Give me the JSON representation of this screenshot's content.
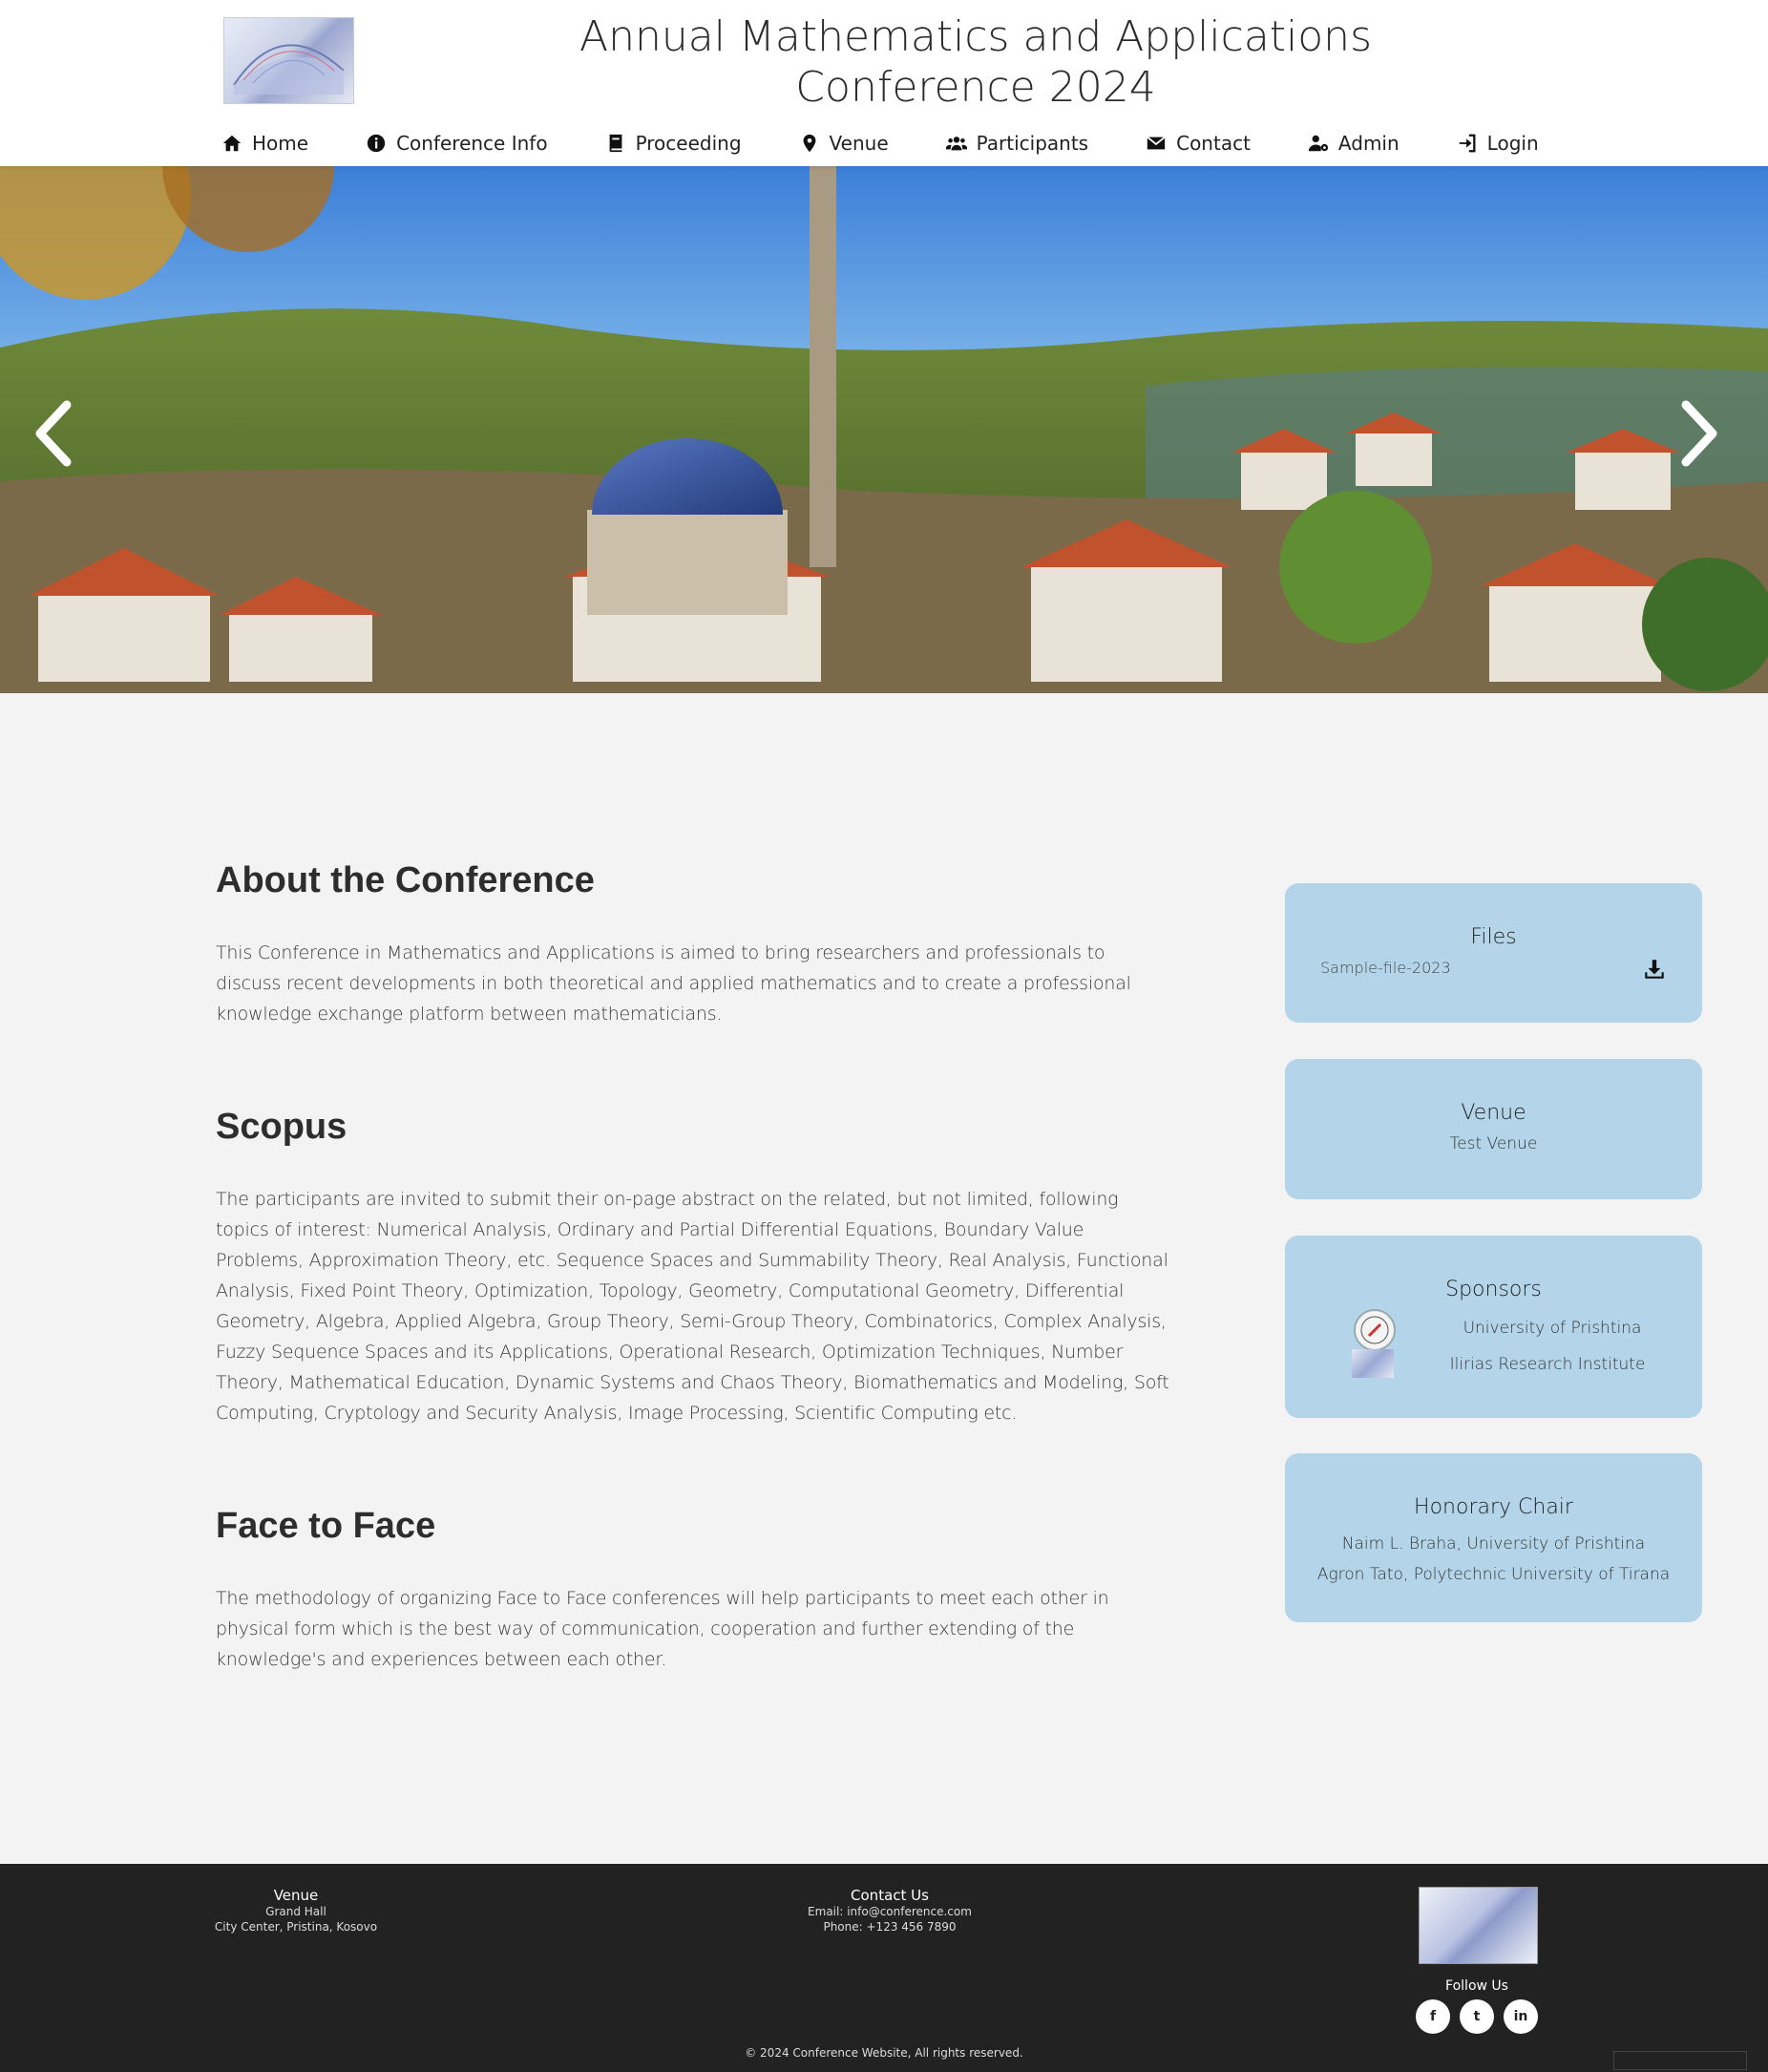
{
  "header": {
    "title_line1": "Annual Mathematics and Applications",
    "title_line2": "Conference 2024"
  },
  "nav": {
    "items": [
      {
        "label": "Home",
        "icon": "home-icon"
      },
      {
        "label": "Conference Info",
        "icon": "info-icon"
      },
      {
        "label": "Proceeding",
        "icon": "book-icon"
      },
      {
        "label": "Venue",
        "icon": "map-pin-icon"
      },
      {
        "label": "Participants",
        "icon": "users-icon"
      },
      {
        "label": "Contact",
        "icon": "envelope-icon"
      },
      {
        "label": "Admin",
        "icon": "user-cog-icon"
      },
      {
        "label": "Login",
        "icon": "login-icon"
      }
    ]
  },
  "about": {
    "title": "About the Conference",
    "text": "This Conference in Mathematics and Applications is aimed to bring researchers and professionals to discuss recent developments in both theoretical and applied mathematics and to create a professional knowledge exchange platform between mathematicians."
  },
  "scopus": {
    "title": "Scopus",
    "text": "The participants are invited to submit their on-page abstract on the related, but not limited, following topics of interest: Numerical Analysis, Ordinary and Partial Differential Equations, Boundary Value Problems, Approximation Theory, etc. Sequence Spaces and Summability Theory, Real Analysis, Functional Analysis, Fixed Point Theory, Optimization, Topology, Geometry, Computational Geometry, Differential Geometry, Algebra, Applied Algebra, Group Theory, Semi-Group Theory, Combinatorics, Complex Analysis, Fuzzy Sequence Spaces and its Applications, Operational Research, Optimization Techniques, Number Theory, Mathematical Education, Dynamic Systems and Chaos Theory, Biomathematics and Modeling, Soft Computing, Cryptology and Security Analysis, Image Processing, Scientific Computing etc."
  },
  "face": {
    "title": "Face to Face",
    "text": "The methodology of organizing Face to Face conferences will help participants to meet each other in physical form which is the best way of communication, cooperation and further extending of the knowledge's and experiences between each other."
  },
  "files": {
    "title": "Files",
    "file_name": "Sample-file-2023"
  },
  "venue_card": {
    "title": "Venue",
    "name": "Test Venue"
  },
  "sponsors": {
    "title": "Sponsors",
    "items": [
      "University of Prishtina",
      "Ilirias Research Institute"
    ]
  },
  "honorary": {
    "title": "Honorary Chair",
    "people": [
      "Naim L. Braha, University of Prishtina",
      "Agron Tato, Polytechnic University of Tirana"
    ]
  },
  "footer": {
    "venue_title": "Venue",
    "venue_line1": "Grand Hall",
    "venue_line2": "City Center, Pristina, Kosovo",
    "contact_title": "Contact Us",
    "contact_email": "Email: info@conference.com",
    "contact_phone": "Phone: +123 456 7890",
    "follow_title": "Follow Us",
    "social": [
      "f",
      "t",
      "in"
    ],
    "copyright": "© 2024 Conference Website, All rights reserved."
  }
}
